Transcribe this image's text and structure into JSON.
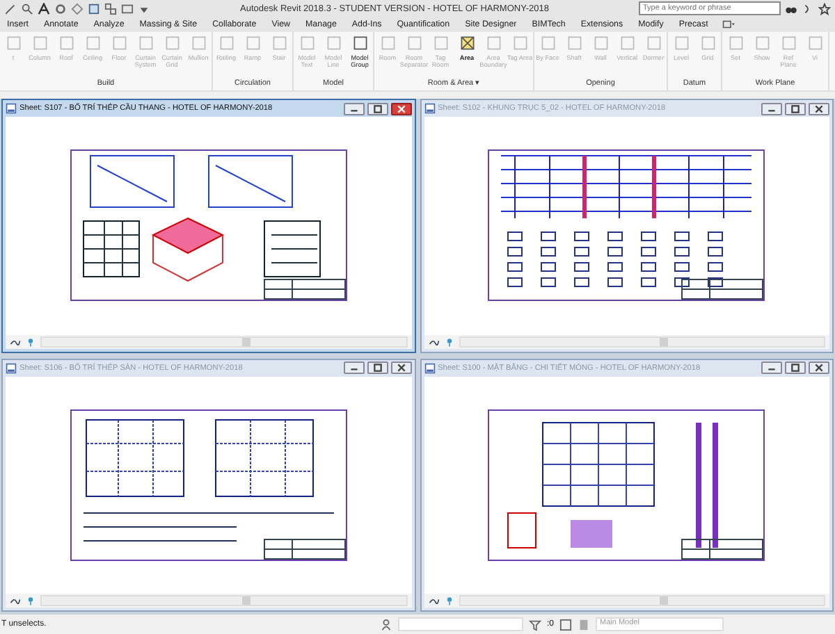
{
  "window": {
    "title": "Autodesk Revit 2018.3 - STUDENT VERSION -   HOTEL OF HARMONY-2018"
  },
  "search": {
    "placeholder": "Type a keyword or phrase"
  },
  "tabs": [
    {
      "label": "Insert",
      "selected": false
    },
    {
      "label": "Annotate",
      "selected": false
    },
    {
      "label": "Analyze",
      "selected": false
    },
    {
      "label": "Massing & Site",
      "selected": false
    },
    {
      "label": "Collaborate",
      "selected": false
    },
    {
      "label": "View",
      "selected": false
    },
    {
      "label": "Manage",
      "selected": false
    },
    {
      "label": "Add-Ins",
      "selected": false
    },
    {
      "label": "Quantification",
      "selected": false
    },
    {
      "label": "Site Designer",
      "selected": false
    },
    {
      "label": "BIMTech",
      "selected": false
    },
    {
      "label": "Extensions",
      "selected": false
    },
    {
      "label": "Modify",
      "selected": false
    },
    {
      "label": "Precast",
      "selected": false
    }
  ],
  "ribbon": [
    {
      "label": "Build",
      "buttons": [
        {
          "label": "t",
          "disabled": true,
          "selected": false
        },
        {
          "label": "Column",
          "disabled": true,
          "selected": false
        },
        {
          "label": "Roof",
          "disabled": true,
          "selected": false
        },
        {
          "label": "Ceiling",
          "disabled": true,
          "selected": false
        },
        {
          "label": "Floor",
          "disabled": true,
          "selected": false
        },
        {
          "label": "Curtain System",
          "disabled": true,
          "selected": false
        },
        {
          "label": "Curtain Grid",
          "disabled": true,
          "selected": false
        },
        {
          "label": "Mullion",
          "disabled": true,
          "selected": false
        }
      ]
    },
    {
      "label": "Circulation",
      "buttons": [
        {
          "label": "Railing",
          "disabled": true,
          "selected": false
        },
        {
          "label": "Ramp",
          "disabled": true,
          "selected": false
        },
        {
          "label": "Stair",
          "disabled": true,
          "selected": false
        }
      ]
    },
    {
      "label": "Model",
      "buttons": [
        {
          "label": "Model Text",
          "disabled": true,
          "selected": false
        },
        {
          "label": "Model Line",
          "disabled": true,
          "selected": false
        },
        {
          "label": "Model Group",
          "disabled": false,
          "selected": false
        }
      ]
    },
    {
      "label": "Room & Area ▾",
      "buttons": [
        {
          "label": "Room",
          "disabled": true,
          "selected": false
        },
        {
          "label": "Room Separator",
          "disabled": true,
          "selected": false
        },
        {
          "label": "Tag Room",
          "disabled": true,
          "selected": false
        },
        {
          "label": "Area",
          "disabled": false,
          "selected": true
        },
        {
          "label": "Area Boundary",
          "disabled": true,
          "selected": false
        },
        {
          "label": "Tag Area",
          "disabled": true,
          "selected": false
        }
      ]
    },
    {
      "label": "Opening",
      "buttons": [
        {
          "label": "By Face",
          "disabled": true,
          "selected": false
        },
        {
          "label": "Shaft",
          "disabled": true,
          "selected": false
        },
        {
          "label": "Wall",
          "disabled": true,
          "selected": false
        },
        {
          "label": "Vertical",
          "disabled": true,
          "selected": false
        },
        {
          "label": "Dormer",
          "disabled": true,
          "selected": false
        }
      ]
    },
    {
      "label": "Datum",
      "buttons": [
        {
          "label": "Level",
          "disabled": true,
          "selected": false
        },
        {
          "label": "Grid",
          "disabled": true,
          "selected": false
        }
      ]
    },
    {
      "label": "Work Plane",
      "buttons": [
        {
          "label": "Set",
          "disabled": true,
          "selected": false
        },
        {
          "label": "Show",
          "disabled": true,
          "selected": false
        },
        {
          "label": "Ref Plane",
          "disabled": true,
          "selected": false
        },
        {
          "label": "Vi",
          "disabled": true,
          "selected": false
        }
      ]
    }
  ],
  "views": [
    {
      "title": "Sheet: S107 - BỐ TRÍ THÉP CẦU THANG - HOTEL OF HARMONY-2018",
      "selected": true
    },
    {
      "title": "Sheet: S102 - KHUNG TRỤC 5_02 - HOTEL OF HARMONY-2018",
      "selected": false
    },
    {
      "title": "Sheet: S106 - BỐ TRÍ THÉP SÀN - HOTEL OF HARMONY-2018",
      "selected": false
    },
    {
      "title": "Sheet: S100 - MẶT BẰNG - CHI TIẾT MÓNG - HOTEL OF HARMONY-2018",
      "selected": false
    }
  ],
  "status_bar": {
    "message": "T unselects.",
    "selection_count": ":0",
    "model": "Main Model"
  }
}
